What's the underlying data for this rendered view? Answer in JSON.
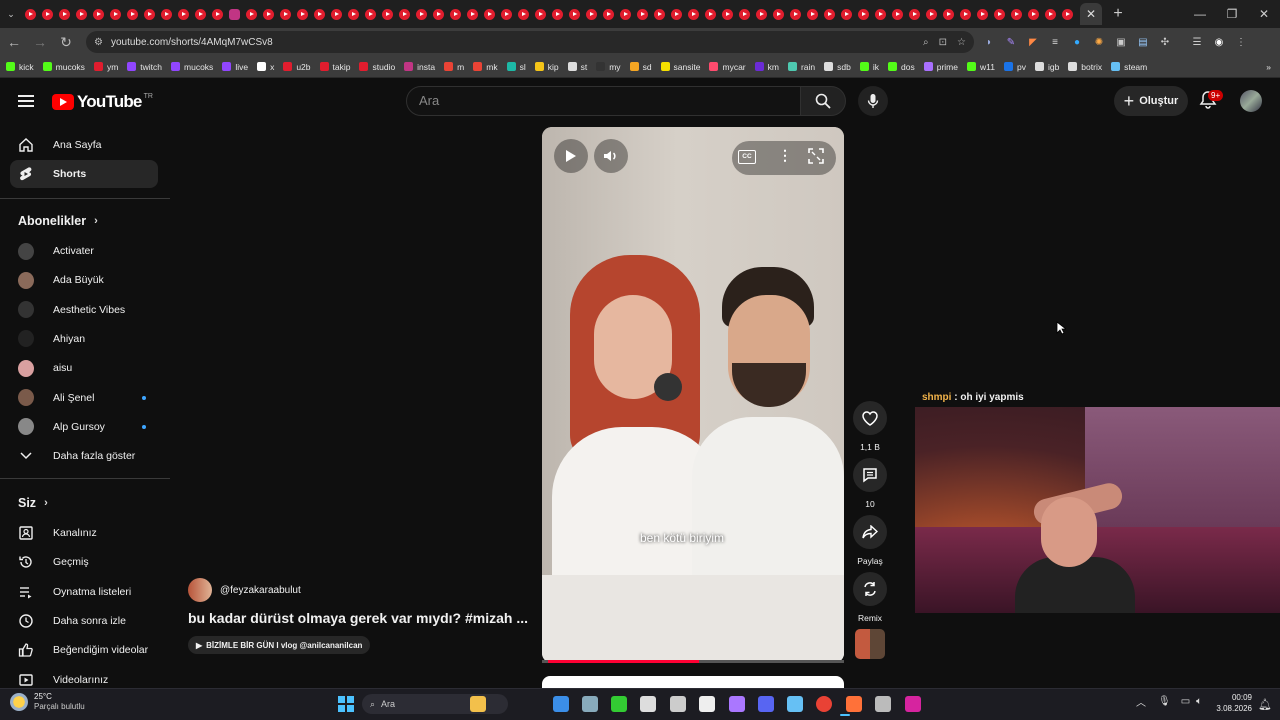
{
  "browser": {
    "url": "youtube.com/shorts/4AMqM7wCSv8",
    "active_tab_close": "✕",
    "new_tab": "+",
    "window_controls": {
      "minimize": "—",
      "restore": "❐",
      "close": "✕"
    }
  },
  "bookmarks": [
    {
      "label": "kick",
      "color": "#53fc18"
    },
    {
      "label": "mucoks",
      "color": "#53fc18"
    },
    {
      "label": "ym",
      "color": "#e11d2e"
    },
    {
      "label": "twitch",
      "color": "#9146ff"
    },
    {
      "label": "mucoks",
      "color": "#9146ff"
    },
    {
      "label": "live",
      "color": "#9146ff"
    },
    {
      "label": "x",
      "color": "#ffffff"
    },
    {
      "label": "u2b",
      "color": "#e11d2e"
    },
    {
      "label": "takip",
      "color": "#e11d2e"
    },
    {
      "label": "studio",
      "color": "#e11d2e"
    },
    {
      "label": "insta",
      "color": "#c13584"
    },
    {
      "label": "m",
      "color": "#ea4335"
    },
    {
      "label": "mk",
      "color": "#ea4335"
    },
    {
      "label": "sl",
      "color": "#1db9a6"
    },
    {
      "label": "kip",
      "color": "#f5c518"
    },
    {
      "label": "st",
      "color": "#dddddd"
    },
    {
      "label": "my",
      "color": "#333333"
    },
    {
      "label": "sd",
      "color": "#f5a623"
    },
    {
      "label": "sansite",
      "color": "#f5e000"
    },
    {
      "label": "mycar",
      "color": "#ff4b6e"
    },
    {
      "label": "km",
      "color": "#6b2bd6"
    },
    {
      "label": "rain",
      "color": "#4ec9b0"
    },
    {
      "label": "sdb",
      "color": "#dddddd"
    },
    {
      "label": "ik",
      "color": "#53fc18"
    },
    {
      "label": "dos",
      "color": "#53fc18"
    },
    {
      "label": "prime",
      "color": "#a970ff"
    },
    {
      "label": "w11",
      "color": "#53fc18"
    },
    {
      "label": "pv",
      "color": "#1a73e8"
    },
    {
      "label": "igb",
      "color": "#dddddd"
    },
    {
      "label": "botrix",
      "color": "#dddddd"
    },
    {
      "label": "steam",
      "color": "#66c0f4"
    }
  ],
  "header": {
    "logo": "YouTube",
    "country": "TR",
    "search_placeholder": "Ara",
    "create_label": "Oluştur",
    "notifications": "9+"
  },
  "sidebar": {
    "main": [
      {
        "label": "Ana Sayfa",
        "icon": "home-icon"
      },
      {
        "label": "Shorts",
        "icon": "shorts-icon"
      }
    ],
    "subs_title": "Abonelikler",
    "subs": [
      {
        "label": "Activater",
        "color": "#444444",
        "dot": false
      },
      {
        "label": "Ada Büyük",
        "color": "#8a6a5a",
        "dot": false
      },
      {
        "label": "Aesthetic Vibes",
        "color": "#333333",
        "dot": false
      },
      {
        "label": "Ahiyan",
        "color": "#222222",
        "dot": false
      },
      {
        "label": "aisu",
        "color": "#d9a0a0",
        "dot": false
      },
      {
        "label": "Ali Şenel",
        "color": "#7a5a4a",
        "dot": true
      },
      {
        "label": "Alp Gursoy",
        "color": "#888888",
        "dot": true
      }
    ],
    "show_more": "Daha fazla göster",
    "you_title": "Siz",
    "you": [
      {
        "label": "Kanalınız",
        "icon": "channel-icon"
      },
      {
        "label": "Geçmiş",
        "icon": "history-icon"
      },
      {
        "label": "Oynatma listeleri",
        "icon": "playlists-icon"
      },
      {
        "label": "Daha sonra izle",
        "icon": "watch-later-icon"
      },
      {
        "label": "Beğendiğim videolar",
        "icon": "liked-icon"
      },
      {
        "label": "Videolarınız",
        "icon": "your-videos-icon"
      }
    ]
  },
  "short": {
    "caption": "ben kötü biriyim",
    "progress": 0.5,
    "channel": "@feyzakaraabulut",
    "title": "bu kadar dürüst olmaya gerek var mıydı? #mizah ...",
    "linked_video": "BİZİMLE BİR GÜN I vlog @anilcananilcan",
    "likes": "1,1 B",
    "comments": "10",
    "share_label": "Paylaş",
    "remix_label": "Remix"
  },
  "overlay": {
    "chat_user": "shmpi",
    "chat_sep": " : ",
    "chat_msg": "oh iyi yapmis"
  },
  "taskbar": {
    "temp": "25°C",
    "weather": "Parçalı bulutlu",
    "search": "Ara",
    "time": "00:09",
    "date": "3.08.2026"
  }
}
